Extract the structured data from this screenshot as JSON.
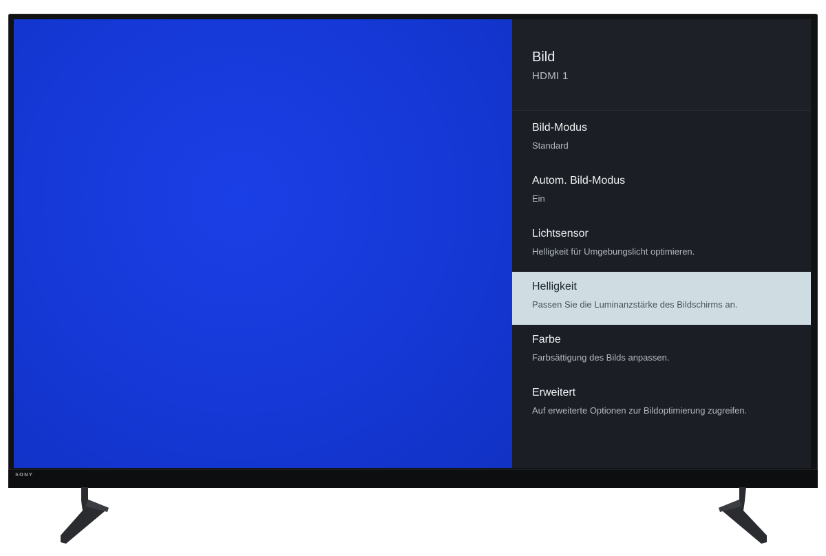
{
  "tv": {
    "brand": "SONY"
  },
  "settings_panel": {
    "title": "Bild",
    "subtitle": "HDMI 1",
    "items": [
      {
        "label": "Bild-Modus",
        "description": "Standard",
        "selected": false
      },
      {
        "label": "Autom. Bild-Modus",
        "description": "Ein",
        "selected": false
      },
      {
        "label": "Lichtsensor",
        "description": "Helligkeit für Umgebungslicht optimieren.",
        "selected": false
      },
      {
        "label": "Helligkeit",
        "description": "Passen Sie die Luminanzstärke des Bildschirms an.",
        "selected": true
      },
      {
        "label": "Farbe",
        "description": "Farbsättigung des Bilds anpassen.",
        "selected": false
      },
      {
        "label": "Erweitert",
        "description": "Auf erweiterte Optionen zur Bildoptimierung zugreifen.",
        "selected": false
      }
    ]
  },
  "colors": {
    "content_blue": "#1538d6",
    "panel_background": "#1b1e24",
    "selected_item": "#cfdde2"
  }
}
